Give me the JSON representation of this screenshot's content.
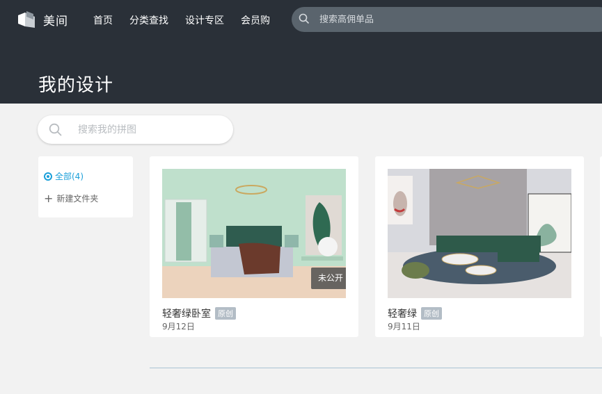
{
  "brand": {
    "name": "美间"
  },
  "nav": {
    "items": [
      "首页",
      "分类查找",
      "设计专区",
      "会员购"
    ]
  },
  "top_search": {
    "placeholder": "搜索高佣单品"
  },
  "page": {
    "title": "我的设计"
  },
  "my_search": {
    "placeholder": "搜索我的拼图"
  },
  "sidebar": {
    "all_label": "全部(4)",
    "new_folder_label": "新建文件夹"
  },
  "designs": [
    {
      "name": "轻奢绿卧室",
      "badge": "原创",
      "date": "9月12日",
      "private_label": "未公开"
    },
    {
      "name": "轻奢绿",
      "badge": "原创",
      "date": "9月11日"
    }
  ],
  "colors": {
    "header_bg": "#2a3038",
    "accent": "#1a9fd9",
    "page_bg": "#f2f2f2"
  }
}
